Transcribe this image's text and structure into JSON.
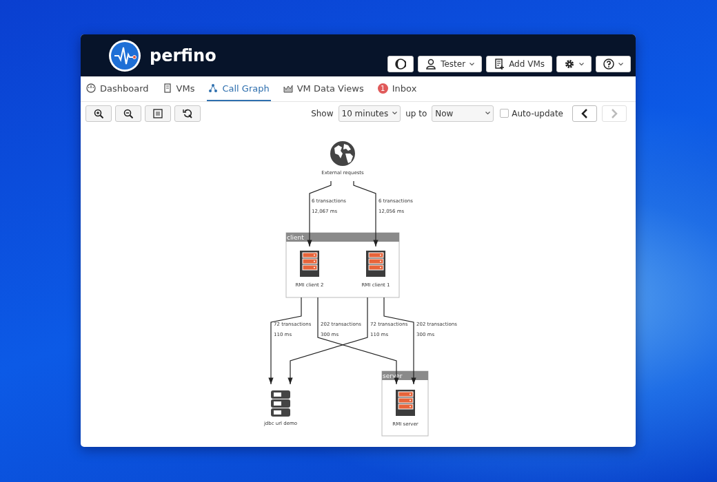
{
  "header": {
    "app_name": "perfino",
    "buttons": [
      {
        "kind": "theme",
        "dropdown": false
      },
      {
        "kind": "user",
        "label": "Tester",
        "dropdown": true
      },
      {
        "kind": "add",
        "label": "Add VMs",
        "dropdown": false
      },
      {
        "kind": "settings",
        "dropdown": true
      },
      {
        "kind": "help",
        "dropdown": true
      }
    ]
  },
  "tabs": [
    {
      "label": "Dashboard",
      "kind": "dashboard",
      "selected": false
    },
    {
      "label": "VMs",
      "kind": "vms",
      "selected": false
    },
    {
      "label": "Call Graph",
      "kind": "graph",
      "selected": true
    },
    {
      "label": "VM Data Views",
      "kind": "chart",
      "selected": false
    },
    {
      "label": "Inbox",
      "kind": "inbox",
      "selected": false,
      "badge": "1"
    }
  ],
  "toolbar": {
    "tools": [
      {
        "kind": "zoom-in"
      },
      {
        "kind": "zoom-out"
      },
      {
        "kind": "fit"
      },
      {
        "kind": "reset"
      }
    ],
    "show_label": "Show",
    "range": "10 minutes",
    "up_to_label": "up to",
    "end": "Now",
    "auto_update": {
      "label": "Auto-update",
      "checked": false
    },
    "nav": [
      {
        "kind": "prev",
        "disabled": false
      },
      {
        "kind": "next",
        "disabled": true
      }
    ]
  },
  "graph": {
    "groups": [
      {
        "label": "client"
      },
      {
        "label": "server"
      }
    ],
    "nodes": [
      {
        "label": "External requests",
        "kind": "globe"
      },
      {
        "label": "RMI client 2",
        "kind": "server"
      },
      {
        "label": "RMI client 1",
        "kind": "server"
      },
      {
        "label": "jdbc url demo",
        "kind": "database"
      },
      {
        "label": "RMI server",
        "kind": "server"
      }
    ],
    "edges": [
      {
        "transactions": "6 transactions",
        "time": "12,067 ms"
      },
      {
        "transactions": "6 transactions",
        "time": "12,056 ms"
      },
      {
        "transactions": "72 transactions",
        "time": "110 ms"
      },
      {
        "transactions": "202 transactions",
        "time": "300 ms"
      },
      {
        "transactions": "72 transactions",
        "time": "110 ms"
      },
      {
        "transactions": "202 transactions",
        "time": "300 ms"
      }
    ]
  }
}
